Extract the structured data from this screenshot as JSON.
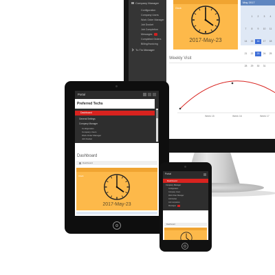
{
  "colors": {
    "clock_panel": "#fdb94a",
    "menu_active": "#d8231f",
    "sidebar": "#353535",
    "calendar_header": "#5f86c0",
    "chart_line": "#d8231f"
  },
  "monitor": {
    "sidebar": {
      "company_manager": "Company Manager",
      "sub_items": [
        "Configuration",
        "Company Users",
        "Work Order Manager",
        "Job Docket",
        "Job Completion",
        "Messages",
        "Completed Orders",
        "Billing/Invoicing"
      ],
      "tu_tio_manager": "Tu Tio Manager"
    },
    "clock": {
      "header": "Clock",
      "date": "2017-May-23"
    },
    "calendar": {
      "header": "May 2017",
      "days": [
        "",
        "1",
        "2",
        "3",
        "4",
        "5",
        "6",
        "7",
        "8",
        "9",
        "10",
        "11",
        "12",
        "13",
        "14",
        "15",
        "16",
        "17",
        "18",
        "19",
        "20",
        "21",
        "22",
        "23",
        "24",
        "25",
        "26",
        "27",
        "28",
        "29",
        "30",
        "31"
      ],
      "highlighted": [
        "16",
        "23"
      ]
    },
    "weekly_visit": {
      "title": "Weekly Visit",
      "tick_labels": [
        "Week 15",
        "Week 16",
        "Week 17"
      ]
    }
  },
  "tablet": {
    "brand": "Portal",
    "menu_heading": "Preferred Techs",
    "dashboard_item": "Dashboard",
    "menu_items": [
      "General Settings",
      "Company Manager"
    ],
    "sub_items": [
      "Configuration",
      "Company Users",
      "Work Order Manager",
      "Job Docket"
    ],
    "page_title": "Dashboard",
    "breadcrumb": "Dashboard",
    "clock": {
      "header": "Clock",
      "date": "2017-May-23"
    }
  },
  "phone": {
    "brand": "Portal",
    "dashboard_item": "Dashboard",
    "menu_items": [
      "Company Manager"
    ],
    "sub_items": [
      "Configuration",
      "Company Users",
      "Work Order Manager",
      "Job Docket",
      "Job Completion",
      "Messages"
    ],
    "breadcrumb": "Dashboard"
  }
}
